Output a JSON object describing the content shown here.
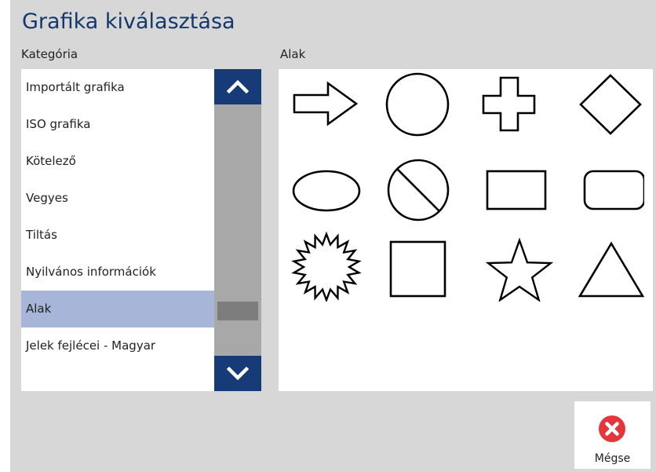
{
  "dialog": {
    "title": "Grafika kiválasztása"
  },
  "category": {
    "label": "Kategória",
    "selected": "Alak",
    "items": [
      {
        "label": "Importált grafika",
        "selected": false
      },
      {
        "label": "ISO grafika",
        "selected": false
      },
      {
        "label": "Kötelező",
        "selected": false
      },
      {
        "label": "Vegyes",
        "selected": false
      },
      {
        "label": "Tiltás",
        "selected": false
      },
      {
        "label": "Nyilvános információk",
        "selected": false
      },
      {
        "label": "Alak",
        "selected": true
      },
      {
        "label": "Jelek fejlécei - Magyar",
        "selected": false
      }
    ]
  },
  "scrollbar": {
    "up_icon": "chevron-up-icon",
    "down_icon": "chevron-down-icon"
  },
  "shapes": {
    "label": "Alak",
    "items": [
      {
        "icon": "arrow-right-outline-icon"
      },
      {
        "icon": "circle-outline-icon"
      },
      {
        "icon": "cross-outline-icon"
      },
      {
        "icon": "diamond-outline-icon"
      },
      {
        "icon": "ellipse-outline-icon"
      },
      {
        "icon": "prohibition-circle-icon"
      },
      {
        "icon": "rectangle-outline-icon"
      },
      {
        "icon": "rounded-rectangle-outline-icon"
      },
      {
        "icon": "starburst-outline-icon"
      },
      {
        "icon": "square-outline-icon"
      },
      {
        "icon": "star-outline-icon"
      },
      {
        "icon": "triangle-outline-icon"
      }
    ]
  },
  "cancel": {
    "label": "Mégse",
    "icon": "close-circle-icon"
  },
  "colors": {
    "title": "#14386b",
    "selection": "#a7b6d8",
    "scroll_button": "#173b76",
    "cancel_icon": "#e5363b",
    "background": "#d7d7d7"
  }
}
